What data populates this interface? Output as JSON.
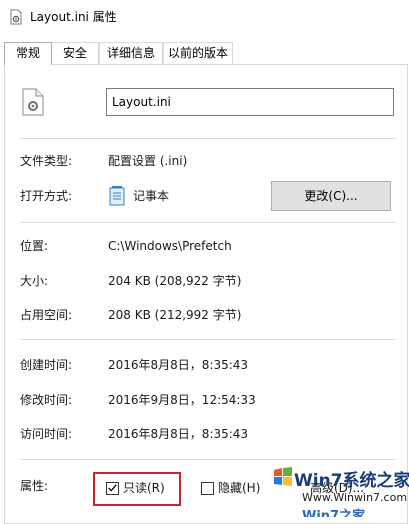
{
  "window": {
    "title": "Layout.ini 属性"
  },
  "tabs": [
    {
      "label": "常规",
      "active": true
    },
    {
      "label": "安全",
      "active": false
    },
    {
      "label": "详细信息",
      "active": false
    },
    {
      "label": "以前的版本",
      "active": false
    }
  ],
  "file": {
    "name": "Layout.ini",
    "icon": "settings-file-icon"
  },
  "info": {
    "type_label": "文件类型:",
    "type_value": "配置设置 (.ini)",
    "open_label": "打开方式:",
    "open_value": "记事本",
    "open_icon": "notepad-icon",
    "change_button": "更改(C)..."
  },
  "location": {
    "location_label": "位置:",
    "location_value": "C:\\Windows\\Prefetch",
    "size_label": "大小:",
    "size_value": "204 KB (208,922 字节)",
    "disk_label": "占用空间:",
    "disk_value": "208 KB (212,992 字节)"
  },
  "times": {
    "created_label": "创建时间:",
    "created_value": "2016年8月8日，8:35:43",
    "modified_label": "修改时间:",
    "modified_value": "2016年9月8日，12:54:33",
    "accessed_label": "访问时间:",
    "accessed_value": "2016年8月8日，8:35:43"
  },
  "attributes": {
    "label": "属性:",
    "readonly_label": "只读(R)",
    "readonly_checked": true,
    "hidden_label": "隐藏(H)",
    "hidden_checked": false,
    "advanced_button": "高级(D)..."
  },
  "watermark": {
    "line1": "Win7系统之家",
    "line2": "Www.Winwin7.com",
    "line3": "Win7之家"
  },
  "colors": {
    "highlight": "#c8242b",
    "button_face": "#e1e1e1",
    "border": "#adadad"
  }
}
